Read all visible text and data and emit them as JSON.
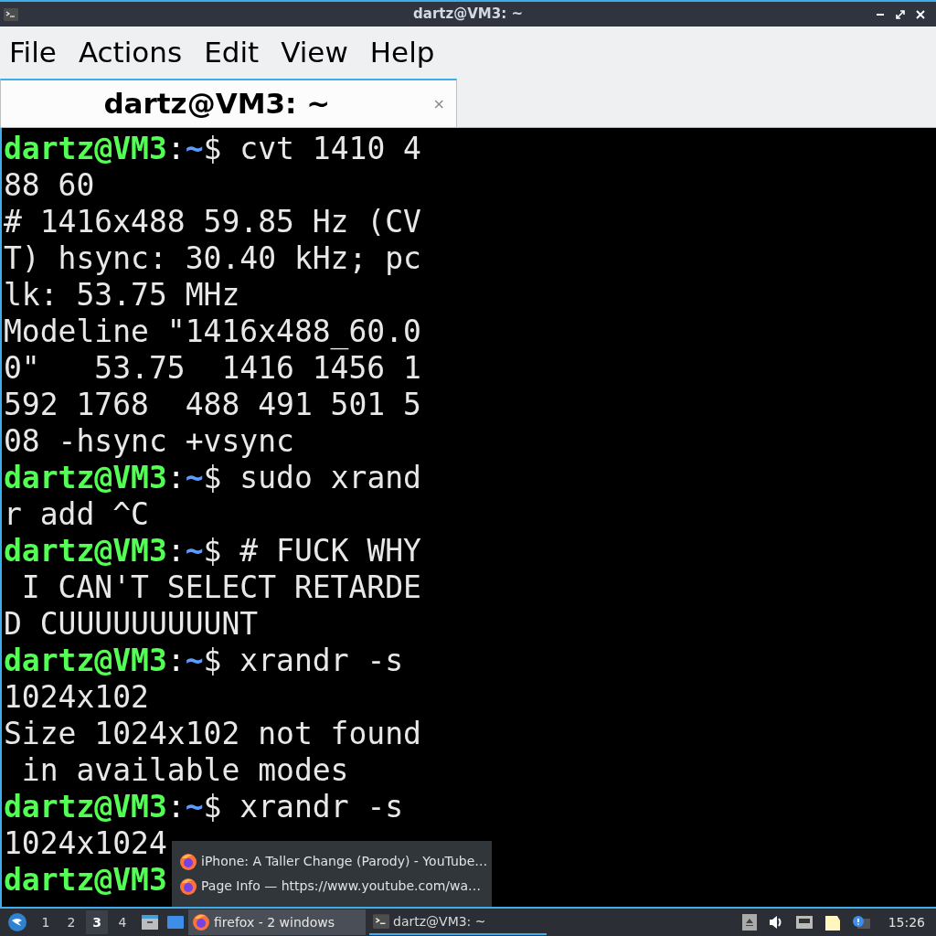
{
  "window": {
    "title": "dartz@VM3: ~"
  },
  "menu": [
    "File",
    "Actions",
    "Edit",
    "View",
    "Help"
  ],
  "tabs": [
    {
      "label": "dartz@VM3: ~",
      "selected": true,
      "close": "×"
    }
  ],
  "terminal": [
    {
      "kind": "prompt",
      "user": "dartz@VM3",
      "colon": ":",
      "path": "~",
      "dollar": "$",
      "command": " cvt 1410 4"
    },
    {
      "kind": "output",
      "text": "88 60"
    },
    {
      "kind": "output",
      "text": "# 1416x488 59.85 Hz (CV"
    },
    {
      "kind": "output",
      "text": "T) hsync: 30.40 kHz; pc"
    },
    {
      "kind": "output",
      "text": "lk: 53.75 MHz"
    },
    {
      "kind": "output",
      "text": "Modeline \"1416x488_60.0"
    },
    {
      "kind": "output",
      "text": "0\"   53.75  1416 1456 1"
    },
    {
      "kind": "output",
      "text": "592 1768  488 491 501 5"
    },
    {
      "kind": "output",
      "text": "08 -hsync +vsync"
    },
    {
      "kind": "prompt",
      "user": "dartz@VM3",
      "colon": ":",
      "path": "~",
      "dollar": "$",
      "command": " sudo xrand"
    },
    {
      "kind": "output",
      "text": "r add ^C"
    },
    {
      "kind": "prompt",
      "user": "dartz@VM3",
      "colon": ":",
      "path": "~",
      "dollar": "$",
      "command": " # FUCK WHY"
    },
    {
      "kind": "output",
      "text": " I CAN'T SELECT RETARDE"
    },
    {
      "kind": "output",
      "text": "D CUUUUUUUUUNT"
    },
    {
      "kind": "prompt",
      "user": "dartz@VM3",
      "colon": ":",
      "path": "~",
      "dollar": "$",
      "command": " xrandr -s"
    },
    {
      "kind": "output",
      "text": "1024x102"
    },
    {
      "kind": "output",
      "text": "Size 1024x102 not found"
    },
    {
      "kind": "output",
      "text": " in available modes"
    },
    {
      "kind": "prompt",
      "user": "dartz@VM3",
      "colon": ":",
      "path": "~",
      "dollar": "$",
      "command": " xrandr -s"
    },
    {
      "kind": "output",
      "text": "1024x1024"
    },
    {
      "kind": "prompt",
      "user": "dartz@VM3"
    }
  ],
  "popup": [
    "iPhone: A Taller Change (Parody) - YouTube…",
    "Page Info — https://www.youtube.com/wa…"
  ],
  "taskbar": {
    "desktops": [
      {
        "label": "1",
        "selected": false
      },
      {
        "label": "2",
        "selected": false
      },
      {
        "label": "3",
        "selected": true
      },
      {
        "label": "4",
        "selected": false
      }
    ],
    "tasks": [
      {
        "label": "firefox - 2 windows",
        "kind": "browser",
        "selected": true
      },
      {
        "label": "dartz@VM3: ~",
        "kind": "terminal",
        "selected": false
      }
    ],
    "clock": "15:26"
  }
}
